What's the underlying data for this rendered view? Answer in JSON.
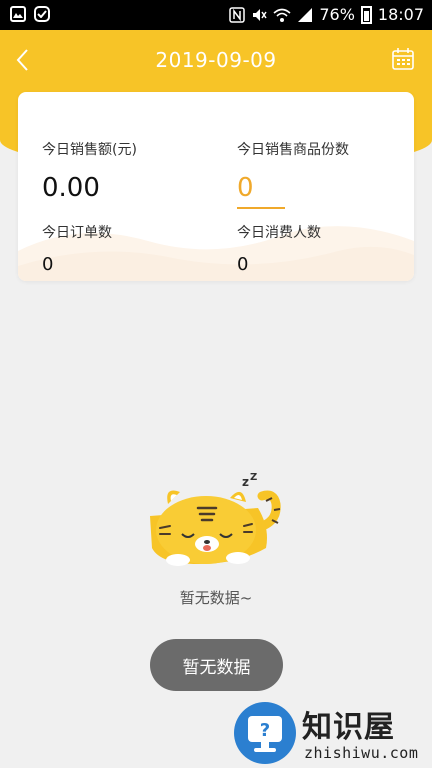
{
  "status_bar": {
    "battery": "76%",
    "time": "18:07",
    "icons": [
      "gallery-icon",
      "check-app-icon",
      "nfc-icon",
      "mute-icon",
      "wifi-icon",
      "signal-icon",
      "battery-icon"
    ]
  },
  "header": {
    "title": "2019-09-09",
    "back_icon": "chevron-left-icon",
    "calendar_icon": "calendar-icon"
  },
  "stats": {
    "sales_amount_label": "今日销售额(元)",
    "sales_amount_value": "0.00",
    "goods_count_label": "今日销售商品份数",
    "goods_count_value": "0",
    "orders_label": "今日订单数",
    "orders_value": "0",
    "customers_label": "今日消费人数",
    "customers_value": "0"
  },
  "empty_state": {
    "text": "暂无数据~",
    "button_label": "暂无数据",
    "illustration": "sleeping-tiger-icon"
  },
  "watermark": {
    "title": "知识屋",
    "subtitle": "zhishiwu.com"
  },
  "colors": {
    "header": "#f7c427",
    "accent": "#f0a92b",
    "button": "#6b6b6b",
    "background": "#f0f0f0"
  }
}
